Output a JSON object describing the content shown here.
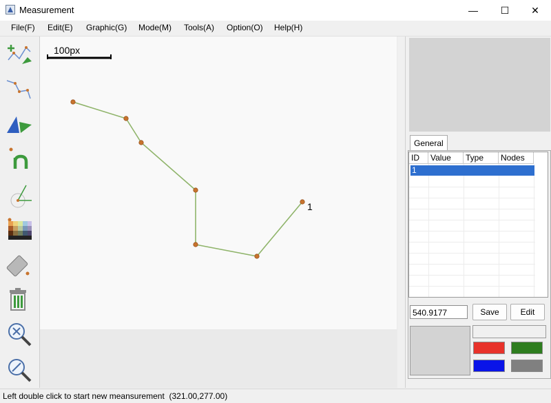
{
  "window": {
    "title": "Measurement",
    "minimize_glyph": "—",
    "maximize_glyph": "☐",
    "close_glyph": "✕"
  },
  "menu": [
    {
      "label": "File(F)"
    },
    {
      "label": "Edit(E)"
    },
    {
      "label": "Graphic(G)"
    },
    {
      "label": "Mode(M)"
    },
    {
      "label": "Tools(A)"
    },
    {
      "label": "Option(O)"
    },
    {
      "label": "Help(H)"
    }
  ],
  "toolbar": {
    "tools": [
      {
        "icon": "add-point-measure-icon"
      },
      {
        "icon": "polyline-icon"
      },
      {
        "icon": "angle-area-icon"
      },
      {
        "icon": "node-count-icon"
      },
      {
        "icon": "compass-angle-icon"
      },
      {
        "icon": "color-palette-icon"
      },
      {
        "icon": "eraser-icon"
      },
      {
        "icon": "trash-icon"
      },
      {
        "icon": "zoom-reset-icon"
      },
      {
        "icon": "zoom-out-icon"
      }
    ]
  },
  "canvas": {
    "scale_label": "100px",
    "measurement_label": "1",
    "line_color": "#8fb46a",
    "node_color": "#c8742e"
  },
  "panel": {
    "tab_label": "General",
    "columns": [
      "ID",
      "Value",
      "Type",
      "Nodes"
    ],
    "rows": [
      {
        "id": "1",
        "value": "",
        "type": "",
        "nodes": ""
      }
    ],
    "value_field": "540.9177",
    "save_label": "Save",
    "edit_label": "Edit",
    "swatches": [
      "#e8322a",
      "#2e7d1f",
      "#0a14e8",
      "#808080"
    ]
  },
  "status": {
    "message": "Left double click to start new meansurement",
    "coords": "(321.00,277.00)"
  }
}
